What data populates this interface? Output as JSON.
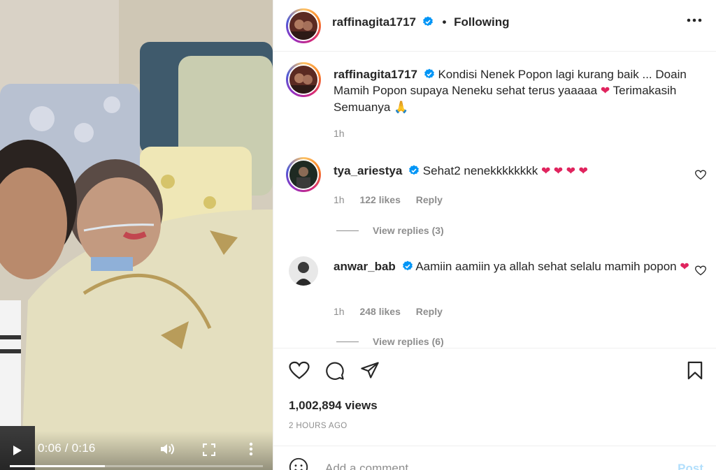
{
  "video": {
    "time_display": "0:06 / 0:16",
    "progress_fraction": 0.375
  },
  "post": {
    "author": "raffinagita1717",
    "follow_status": "Following",
    "caption": "Kondisi Nenek Popon lagi kurang baik ... Doain Mamih Popon supaya Neneku sehat terus yaaaaa",
    "caption_end": "Terimakasih Semuanya",
    "caption_time": "1h",
    "views": "1,002,894 views",
    "posted_ago": "2 HOURS AGO"
  },
  "comments": [
    {
      "username": "tya_ariestya",
      "text": "Sehat2 nenekkkkkkkk",
      "time": "1h",
      "likes": "122 likes",
      "reply_label": "Reply",
      "view_replies": "View replies (3)"
    },
    {
      "username": "anwar_bab",
      "text": "Aamiin aamiin ya allah sehat selalu mamih popon",
      "time": "1h",
      "likes": "248 likes",
      "reply_label": "Reply",
      "view_replies": "View replies (6)"
    }
  ],
  "add_comment": {
    "placeholder": "Add a comment...",
    "post_label": "Post"
  },
  "colors": {
    "accent_blue": "#0095f6",
    "post_disabled": "#b2dffc",
    "heart_red": "#e0245e",
    "muted": "#8e8e8e"
  },
  "icons": [
    "play-icon",
    "volume-icon",
    "fullscreen-icon",
    "more-vertical-icon",
    "verified-icon",
    "more-horizontal-icon",
    "heart-icon",
    "comment-icon",
    "share-icon",
    "bookmark-icon",
    "emoji-icon"
  ]
}
